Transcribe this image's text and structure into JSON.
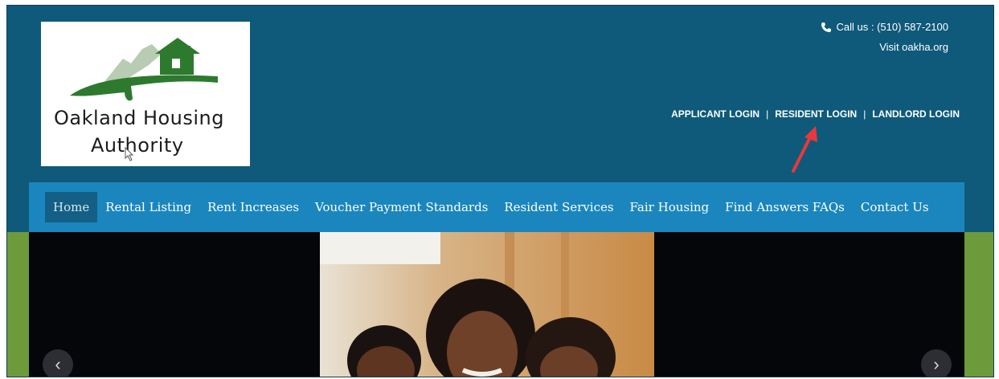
{
  "logo": {
    "line1": "Oakland Housing",
    "line2": "Authority",
    "colors": {
      "green_dark": "#2d7a2e",
      "green_light": "#b7ccb2"
    }
  },
  "header": {
    "phone_icon": "phone-icon",
    "phone_text": "Call us : (510) 587-2100",
    "visit_text": "Visit oakha.org",
    "logins": {
      "applicant": "APPLICANT LOGIN",
      "resident": "RESIDENT LOGIN",
      "landlord": "LANDLORD LOGIN",
      "separator": "|"
    }
  },
  "nav": {
    "items": [
      {
        "label": "Home",
        "active": true
      },
      {
        "label": "Rental Listing"
      },
      {
        "label": "Rent Increases"
      },
      {
        "label": "Voucher Payment Standards"
      },
      {
        "label": "Resident Services"
      },
      {
        "label": "Fair Housing"
      },
      {
        "label": "Find Answers FAQs"
      },
      {
        "label": "Contact Us"
      }
    ]
  },
  "slider": {
    "prev_icon": "chevron-left-icon",
    "next_icon": "chevron-right-icon",
    "prev_glyph": "‹",
    "next_glyph": "›"
  },
  "annotation": {
    "arrow_color": "#e8383b"
  },
  "colors": {
    "header_bg": "#0f5a7a",
    "nav_bg": "#1b86bd",
    "nav_active": "#135f86",
    "side_green": "#6d9a3a"
  }
}
